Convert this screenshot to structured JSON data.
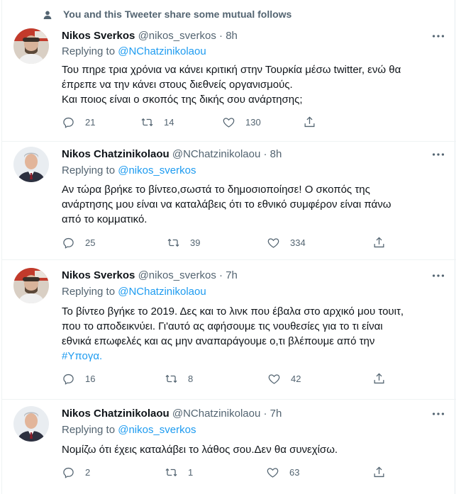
{
  "context": {
    "text": "You and this Tweeter share some mutual follows",
    "icon": "person-icon"
  },
  "tweets": [
    {
      "name": "Nikos Sverkos",
      "handle": "@nikos_sverkos",
      "sep": "·",
      "time": "8h",
      "replying_prefix": "Replying to",
      "replying_to": "@NChatzinikolaou",
      "lines": [
        "Του πηρε τρια χρόνια να κάνει κριτική στην Τουρκία μέσω twitter, ενώ θα",
        "έπρεπε να την κάνει στους διεθνείς οργανισμούς.",
        "Και ποιος είναι ο σκοπός της δικής σου ανάρτησης;"
      ],
      "replies": "21",
      "retweets": "14",
      "likes": "130"
    },
    {
      "name": "Nikos Chatzinikolaou",
      "handle": "@NChatzinikolaou",
      "sep": "·",
      "time": "8h",
      "replying_prefix": "Replying to",
      "replying_to": "@nikos_sverkos",
      "lines": [
        "Αν τώρα βρήκε το βίντεο,σωστά το δημοσιοποίησε! Ο σκοπός της",
        "ανάρτησης μου είναι να καταλάβεις ότι το εθνικό συμφέρον είναι πάνω",
        "από το κομματικό."
      ],
      "replies": "25",
      "retweets": "39",
      "likes": "334"
    },
    {
      "name": "Nikos Sverkos",
      "handle": "@nikos_sverkos",
      "sep": "·",
      "time": "7h",
      "replying_prefix": "Replying to",
      "replying_to": "@NChatzinikolaou",
      "lines": [
        "Το βίντεο βγήκε το 2019. Δες και το λινκ που έβαλα στο αρχικό μου τουιτ,",
        "που το αποδεικνύει. Γι'αυτό ας αφήσουμε τις νουθεσίες για το τι είναι",
        "εθνικά επωφελές και ας μην αναπαράγουμε ο,τι βλέπουμε από την"
      ],
      "hashtag": "#Υπογα.",
      "replies": "16",
      "retweets": "8",
      "likes": "42"
    },
    {
      "name": "Nikos Chatzinikolaou",
      "handle": "@NChatzinikolaou",
      "sep": "·",
      "time": "7h",
      "replying_prefix": "Replying to",
      "replying_to": "@nikos_sverkos",
      "lines": [
        "Νομίζω ότι έχεις καταλάβει το λάθος σου.Δεν θα συνεχίσω."
      ],
      "replies": "2",
      "retweets": "1",
      "likes": "63"
    }
  ],
  "icons": {
    "reply": "comment-icon",
    "retweet": "retweet-icon",
    "like": "heart-icon",
    "share": "share-icon",
    "more": "more-icon"
  },
  "colors": {
    "link": "#1d9bf0",
    "secondary": "#536471",
    "text": "#0f1419"
  }
}
